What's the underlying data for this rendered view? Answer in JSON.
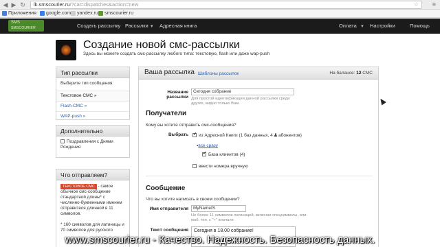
{
  "browser": {
    "url_host": "lk.smscourier.ru",
    "url_path": "/?cat=dispatches&action=new",
    "bookmarks": [
      "Приложения",
      "google.com",
      "yandex.ru",
      "smscourier.ru"
    ]
  },
  "navbar": {
    "logo_line1": "SMS",
    "logo_line2": "SMSCOURIER",
    "links": [
      "Создать рассылку",
      "Рассылки",
      "Адресная книга"
    ],
    "right_links": [
      "Оплата",
      "Настройки",
      "Помощь"
    ]
  },
  "header": {
    "title": "Создание новой смс-рассылки",
    "subtitle": "Здесь вы можете создать смс-рассылку любого типа: текстовую, flash или даже wap-push"
  },
  "sidebar": {
    "type_box": {
      "title": "Тип рассылки",
      "prompt": "Выберите тип сообщения:",
      "items": [
        "Текстовое СМС »",
        "Flash-СМС »",
        "WAP-push »"
      ]
    },
    "extra_box": {
      "title": "Дополнительно",
      "checkbox_label": "Поздравления с Днями Рождения"
    },
    "what_box": {
      "title": "Что отправляем?",
      "badge": "ТЕКСТОВОЕ СМС",
      "text": "- самое обычное смс-сообщение стандартной длины* с численно-буквенными именем отправителя длинной в 11 символов.",
      "note": "* 160 символов для латиницы и 70 символов для русского"
    }
  },
  "main": {
    "title": "Ваша рассылка",
    "templates_link": "Шаблоны рассылок",
    "balance_label": "На балансе:",
    "balance_value": "12",
    "balance_unit": "СМС",
    "name_label": "Название рассылки",
    "name_value": "Сегодня собрание",
    "name_hint": "Для простой идентификации данной рассылки среди других, видно только Вам.",
    "recipients_title": "Получатели",
    "recipients_question": "Кому вы хотите отправить смс-сообщения?",
    "choose_label": "Выбрать",
    "addressbook_text_a": "из Адресной Книги (",
    "addressbook_bases": "1",
    "addressbook_text_b": "баз данных,",
    "addressbook_subscribers": "4",
    "addressbook_text_c": "абонентов)",
    "all_link": "все сразу",
    "base_label": "База клиентов",
    "base_count": "(4)",
    "manual_label": "ввести номера вручную",
    "message_title": "Сообщение",
    "message_question": "Что вы хотите написать в своем сообщении?",
    "sender_label": "Имя отправителя",
    "sender_value": "MyNameIS",
    "sender_hint": "Не более 11 символов латиницей, включая спецсимволы, или моб. тел. с \"+\" вначале",
    "text_label": "Текст сообщения",
    "text_value": "Сегодня в 18.00 собрание!"
  },
  "watermark": "www.smscourier.ru - Качество. Надежность. Безопасность данных."
}
